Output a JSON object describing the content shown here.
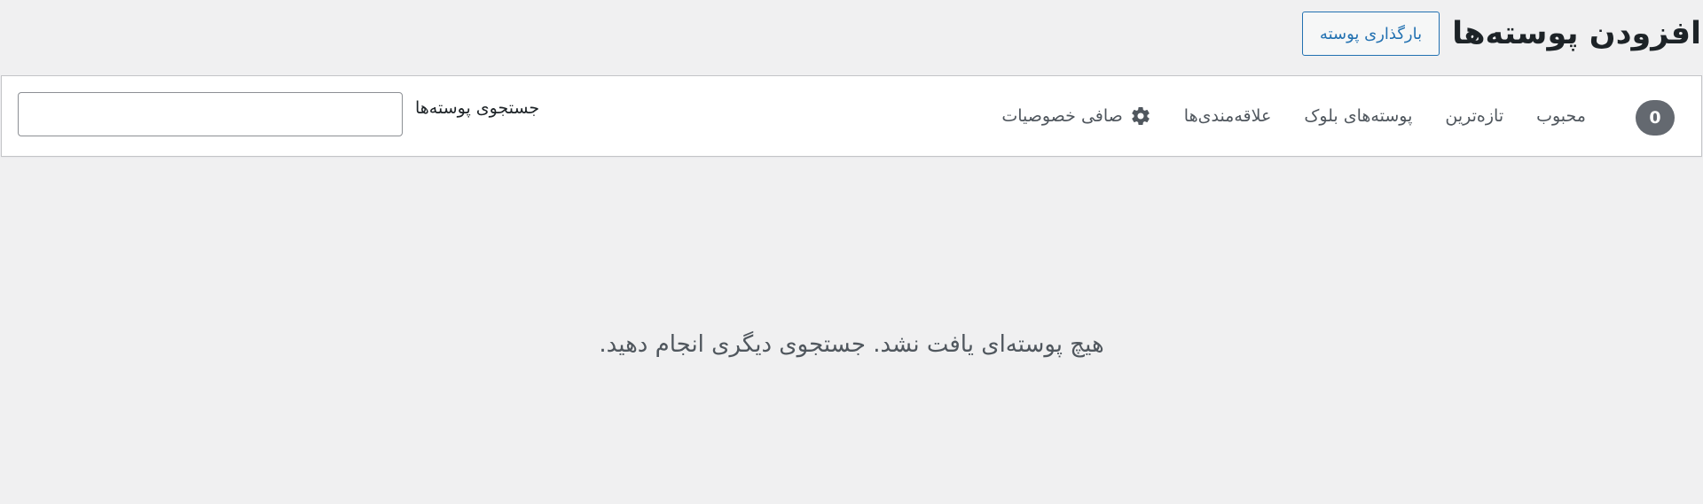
{
  "header": {
    "title": "افزودن پوسته‌ها",
    "upload_label": "بارگذاری پوسته"
  },
  "filter_bar": {
    "count": "0",
    "filters": [
      {
        "label": "محبوب"
      },
      {
        "label": "تازه‌ترین"
      },
      {
        "label": "پوسته‌های بلوک"
      },
      {
        "label": "علاقه‌مندی‌ها"
      }
    ],
    "feature_filter_label": "صافی خصوصیات",
    "feature_filter_icon": "gear-icon",
    "search_label": "جستجوی پوسته‌ها",
    "search_value": ""
  },
  "empty_state": {
    "message": "هیچ پوسته‌ای یافت نشد. جستجوی دیگری انجام دهید."
  },
  "colors": {
    "accent": "#2271b1",
    "background": "#f0f0f1",
    "badge": "#646970",
    "text_muted": "#50575e"
  }
}
